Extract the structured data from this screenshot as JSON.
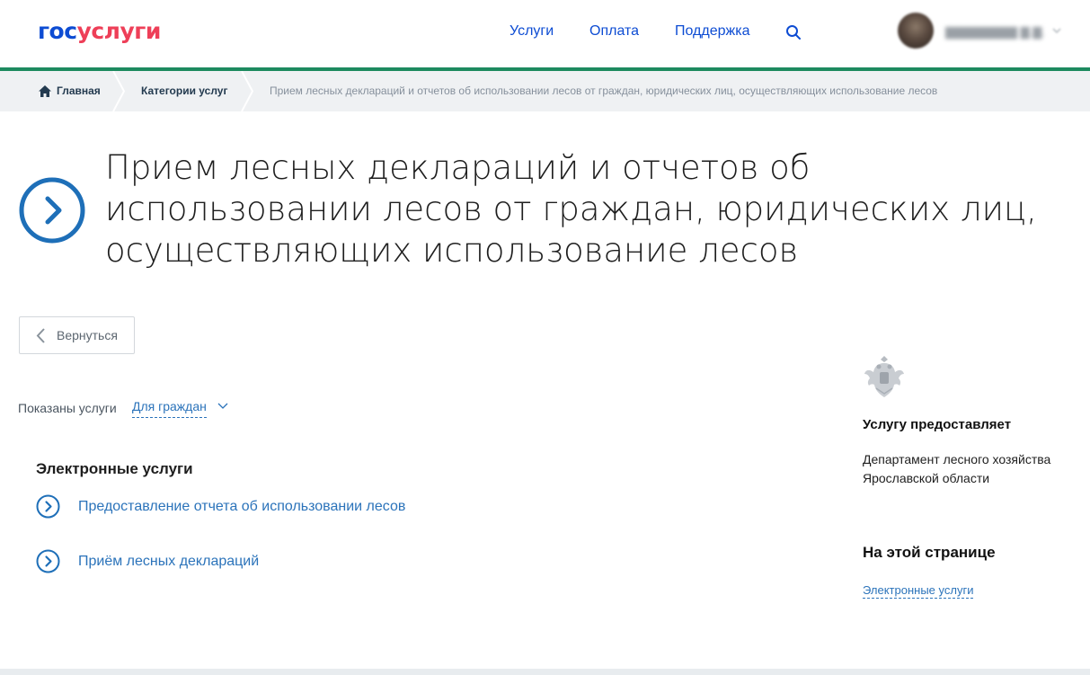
{
  "header": {
    "logo_part1": "гос",
    "logo_part2": "услуги",
    "nav": {
      "uslugi": "Услуги",
      "oplata": "Оплата",
      "podderzhka": "Поддержка"
    },
    "search_icon": "search-icon",
    "user_chevron_icon": "chevron-down-icon",
    "colors": {
      "brand_blue": "#0d4cd3",
      "brand_red": "#ee3f58",
      "accent_green": "#1d8a5f"
    }
  },
  "breadcrumb": {
    "home": "Главная",
    "home_icon": "home-icon",
    "categories": "Категории услуг",
    "current": "Прием лесных деклараций и отчетов об использовании лесов от граждан, юридических лиц, осуществляющих использование лесов"
  },
  "page": {
    "title": "Прием лесных деклараций и отчетов об использовании лесов от граждан, юридических лиц, осуществляющих использование лесов",
    "title_icon": "chevron-right-circle-icon",
    "back_label": "Вернуться",
    "filter_label": "Показаны услуги",
    "filter_value": "Для граждан",
    "section_title": "Электронные услуги",
    "services": [
      {
        "label": "Предоставление отчета об использовании лесов",
        "icon": "chevron-right-circle-icon"
      },
      {
        "label": "Приём лесных деклараций",
        "icon": "chevron-right-circle-icon"
      }
    ]
  },
  "sidebar": {
    "emblem_icon": "coat-of-arms-icon",
    "provider_heading": "Услугу предоставляет",
    "provider_name": "Департамент лесного хозяйства Ярославской области",
    "onpage_heading": "На этой странице",
    "onpage_link": "Электронные услуги"
  },
  "colors": {
    "link_blue": "#2b73ba",
    "icon_blue": "#1e6fb8"
  }
}
